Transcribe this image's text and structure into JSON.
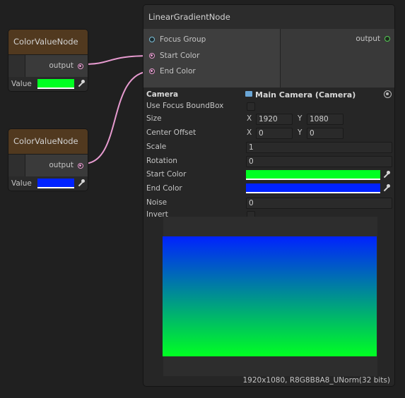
{
  "color_nodes": [
    {
      "title": "ColorValueNode",
      "output_label": "output",
      "value_label": "Value",
      "color": "#00ff22"
    },
    {
      "title": "ColorValueNode",
      "output_label": "output",
      "value_label": "Value",
      "color": "#0022ff"
    }
  ],
  "gradient_node": {
    "title": "LinearGradientNode",
    "inputs": [
      "Focus Group",
      "Start Color",
      "End Color"
    ],
    "output_label": "output",
    "camera_label": "Camera",
    "camera_value": "Main Camera (Camera)",
    "props": {
      "use_focus_label": "Use Focus BoundBox",
      "size_label": "Size",
      "size_x": "1920",
      "size_y": "1080",
      "center_label": "Center Offset",
      "center_x": "0",
      "center_y": "0",
      "scale_label": "Scale",
      "scale_value": "1",
      "rotation_label": "Rotation",
      "rotation_value": "0",
      "start_color_label": "Start Color",
      "start_color": "#00ff22",
      "end_color_label": "End Color",
      "end_color": "#0022ff",
      "noise_label": "Noise",
      "noise_value": "0",
      "invert_label": "Invert",
      "x_label": "X",
      "y_label": "Y"
    },
    "preview_info": "1920x1080, R8G8B8A8_UNorm(32 bits)"
  }
}
